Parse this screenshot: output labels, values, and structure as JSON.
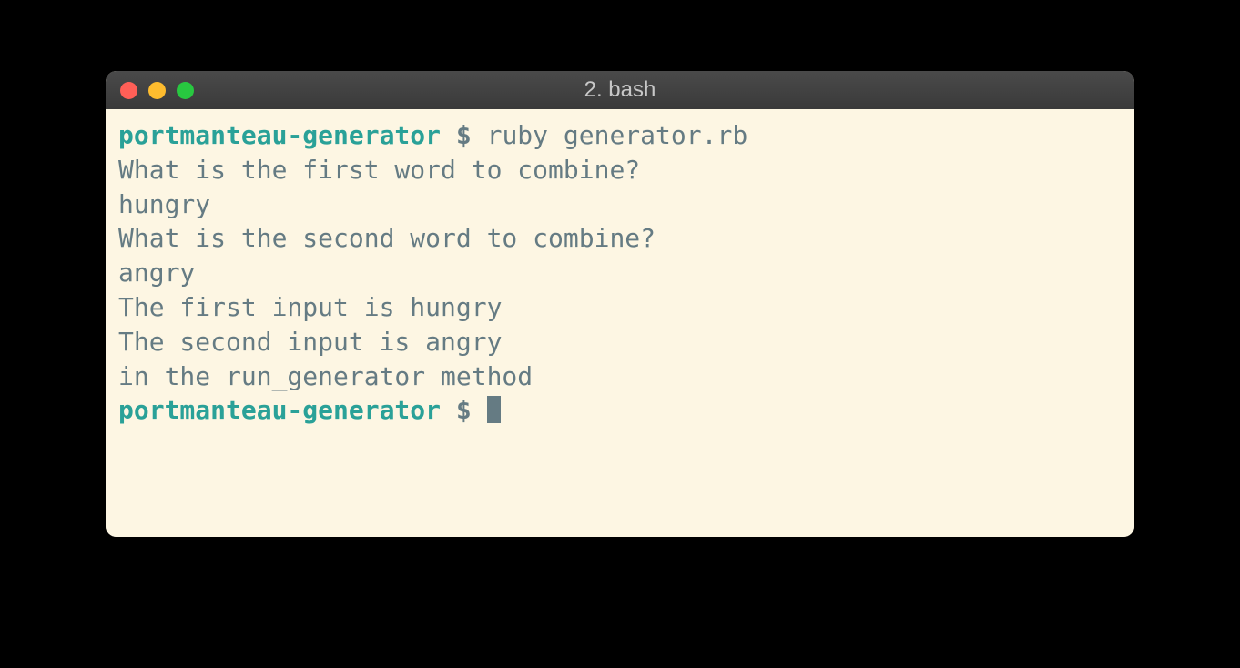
{
  "window": {
    "title": "2. bash"
  },
  "prompt": {
    "dir": "portmanteau-generator",
    "symbol": "$"
  },
  "session": {
    "command": "ruby generator.rb",
    "lines": [
      "What is the first word to combine?",
      "hungry",
      "What is the second word to combine?",
      "angry",
      "The first input is hungry",
      "The second input is angry",
      "in the run_generator method"
    ]
  }
}
